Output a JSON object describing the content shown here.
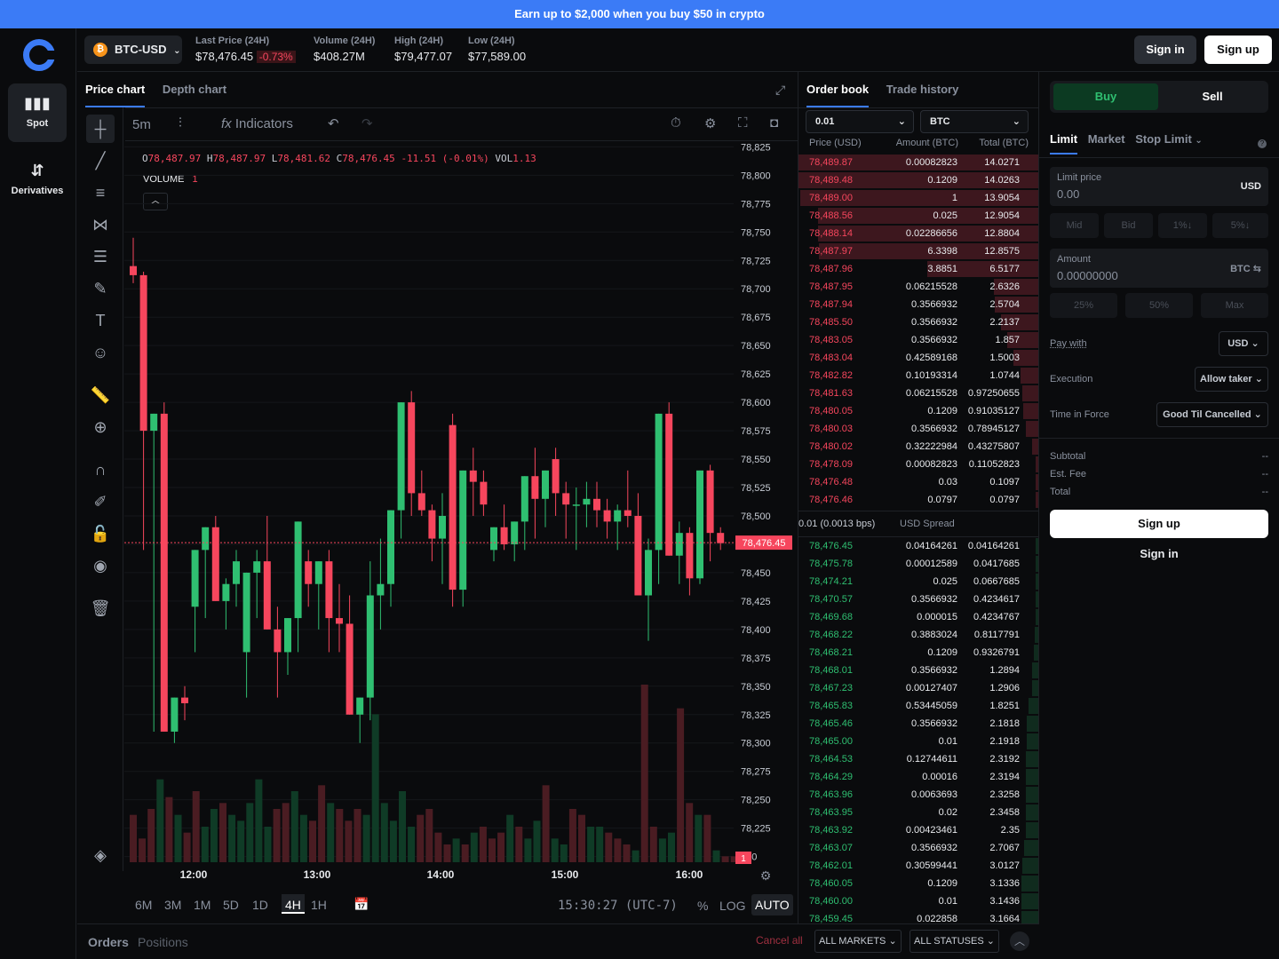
{
  "promo": "Earn up to $2,000 when you buy $50 in crypto",
  "nav": {
    "spot": "Spot",
    "derivatives": "Derivatives"
  },
  "header": {
    "pair": "BTC-USD",
    "coin_symbol": "₿",
    "last_price_label": "Last Price (24H)",
    "last_price": "$78,476.45",
    "change": "-0.73%",
    "volume_label": "Volume (24H)",
    "volume": "$408.27M",
    "high_label": "High (24H)",
    "high": "$79,477.07",
    "low_label": "Low (24H)",
    "low": "$77,589.00",
    "signin": "Sign in",
    "signup": "Sign up"
  },
  "chart_tabs": {
    "price": "Price chart",
    "depth": "Depth chart"
  },
  "toolbar": {
    "interval": "5m",
    "indicators": "Indicators"
  },
  "ohlc": {
    "o_label": "O",
    "o": "78,487.97",
    "h_label": "H",
    "h": "78,487.97",
    "l_label": "L",
    "l": "78,481.62",
    "c_label": "C",
    "c": "78,476.45",
    "delta": "-11.51 (-0.01%)",
    "vol_label": "VOL",
    "vol": "1.13"
  },
  "volume_legend": {
    "label": "VOLUME",
    "value": "1"
  },
  "current_price_tag": "78,476.45",
  "volume_axis_tag": "1",
  "timebar": {
    "ranges": [
      "6M",
      "3M",
      "1M",
      "5D",
      "1D",
      "4H",
      "1H"
    ],
    "active": "4H",
    "clock": "15:30:27 (UTC-7)",
    "pct": "%",
    "log": "LOG",
    "auto": "AUTO"
  },
  "orders_tabs": {
    "orders": "Orders",
    "positions": "Positions",
    "cancel_all": "Cancel all",
    "markets": "ALL MARKETS",
    "statuses": "ALL STATUSES"
  },
  "orderbook": {
    "tab_book": "Order book",
    "tab_history": "Trade history",
    "agg": "0.01",
    "unit": "BTC",
    "col_price": "Price (USD)",
    "col_amount": "Amount (BTC)",
    "col_total": "Total (BTC)",
    "spread": "0.01 (0.0013 bps)",
    "spread_label": "USD Spread",
    "asks": [
      [
        "78,489.87",
        "0.00082823",
        "14.0271"
      ],
      [
        "78,489.48",
        "0.1209",
        "14.0263"
      ],
      [
        "78,489.00",
        "1",
        "13.9054"
      ],
      [
        "78,488.56",
        "0.025",
        "12.9054"
      ],
      [
        "78,488.14",
        "0.02286656",
        "12.8804"
      ],
      [
        "78,487.97",
        "6.3398",
        "12.8575"
      ],
      [
        "78,487.96",
        "3.8851",
        "6.5177"
      ],
      [
        "78,487.95",
        "0.06215528",
        "2.6326"
      ],
      [
        "78,487.94",
        "0.3566932",
        "2.5704"
      ],
      [
        "78,485.50",
        "0.3566932",
        "2.2137"
      ],
      [
        "78,483.05",
        "0.3566932",
        "1.857"
      ],
      [
        "78,483.04",
        "0.42589168",
        "1.5003"
      ],
      [
        "78,482.82",
        "0.10193314",
        "1.0744"
      ],
      [
        "78,481.63",
        "0.06215528",
        "0.97250655"
      ],
      [
        "78,480.05",
        "0.1209",
        "0.91035127"
      ],
      [
        "78,480.03",
        "0.3566932",
        "0.78945127"
      ],
      [
        "78,480.02",
        "0.32222984",
        "0.43275807"
      ],
      [
        "78,478.09",
        "0.00082823",
        "0.11052823"
      ],
      [
        "78,476.48",
        "0.03",
        "0.1097"
      ],
      [
        "78,476.46",
        "0.0797",
        "0.0797"
      ]
    ],
    "bids": [
      [
        "78,476.45",
        "0.04164261",
        "0.04164261"
      ],
      [
        "78,475.78",
        "0.00012589",
        "0.0417685"
      ],
      [
        "78,474.21",
        "0.025",
        "0.0667685"
      ],
      [
        "78,470.57",
        "0.3566932",
        "0.4234617"
      ],
      [
        "78,469.68",
        "0.000015",
        "0.4234767"
      ],
      [
        "78,468.22",
        "0.3883024",
        "0.8117791"
      ],
      [
        "78,468.21",
        "0.1209",
        "0.9326791"
      ],
      [
        "78,468.01",
        "0.3566932",
        "1.2894"
      ],
      [
        "78,467.23",
        "0.00127407",
        "1.2906"
      ],
      [
        "78,465.83",
        "0.53445059",
        "1.8251"
      ],
      [
        "78,465.46",
        "0.3566932",
        "2.1818"
      ],
      [
        "78,465.00",
        "0.01",
        "2.1918"
      ],
      [
        "78,464.53",
        "0.12744611",
        "2.3192"
      ],
      [
        "78,464.29",
        "0.00016",
        "2.3194"
      ],
      [
        "78,463.96",
        "0.0063693",
        "2.3258"
      ],
      [
        "78,463.95",
        "0.02",
        "2.3458"
      ],
      [
        "78,463.92",
        "0.00423461",
        "2.35"
      ],
      [
        "78,463.07",
        "0.3566932",
        "2.7067"
      ],
      [
        "78,462.01",
        "0.30599441",
        "3.0127"
      ],
      [
        "78,460.05",
        "0.1209",
        "3.1336"
      ],
      [
        "78,460.00",
        "0.01",
        "3.1436"
      ],
      [
        "78,459.45",
        "0.022858",
        "3.1664"
      ]
    ]
  },
  "trade": {
    "buy": "Buy",
    "sell": "Sell",
    "order_types": [
      "Limit",
      "Market",
      "Stop Limit"
    ],
    "limit_price_label": "Limit price",
    "limit_price_value": "0.00",
    "limit_currency": "USD",
    "quick_price": [
      "Mid",
      "Bid",
      "1%↓",
      "5%↓"
    ],
    "amount_label": "Amount",
    "amount_value": "0.00000000",
    "amount_currency": "BTC ⇆",
    "quick_amount": [
      "25%",
      "50%",
      "Max"
    ],
    "pay_with_label": "Pay with",
    "pay_with_value": "USD",
    "execution_label": "Execution",
    "execution_value": "Allow taker",
    "tif_label": "Time in Force",
    "tif_value": "Good Til Cancelled",
    "subtotal_label": "Subtotal",
    "fee_label": "Est. Fee",
    "total_label": "Total",
    "empty_value": "--",
    "signup": "Sign up",
    "signin": "Sign in"
  },
  "chart_data": {
    "type": "candlestick",
    "y_ticks": [
      78825,
      78800,
      78775,
      78750,
      78725,
      78700,
      78675,
      78650,
      78625,
      78600,
      78575,
      78550,
      78525,
      78500,
      78475,
      78450,
      78425,
      78400,
      78375,
      78350,
      78325,
      78300,
      78275,
      78250,
      78225,
      78200
    ],
    "y_tick_labels": [
      "78,825",
      "78,800",
      "78,775",
      "78,750",
      "78,725",
      "78,700",
      "78,675",
      "78,650",
      "78,625",
      "78,600",
      "78,575",
      "78,550",
      "78,525",
      "78,500",
      "",
      "78,450",
      "78,425",
      "78,400",
      "78,375",
      "78,350",
      "78,325",
      "78,300",
      "78,275",
      "78,250",
      "78,225",
      "200"
    ],
    "ylim": [
      78195,
      78830
    ],
    "x_labels": [
      "12:00",
      "13:00",
      "14:00",
      "15:00",
      "16:00"
    ],
    "candles": [
      [
        78720,
        78745,
        78705,
        78712
      ],
      [
        78712,
        78715,
        78470,
        78575
      ],
      [
        78575,
        78580,
        78310,
        78590
      ],
      [
        78590,
        78600,
        78330,
        78310
      ],
      [
        78310,
        78320,
        78300,
        78340
      ],
      [
        78340,
        78350,
        78320,
        78335
      ],
      [
        78420,
        78450,
        78380,
        78470
      ],
      [
        78470,
        78490,
        78410,
        78490
      ],
      [
        78490,
        78500,
        78440,
        78425
      ],
      [
        78425,
        78445,
        78400,
        78440
      ],
      [
        78440,
        78470,
        78420,
        78460
      ],
      [
        78380,
        78420,
        78340,
        78450
      ],
      [
        78450,
        78470,
        78410,
        78460
      ],
      [
        78460,
        78500,
        78430,
        78400
      ],
      [
        78400,
        78420,
        78340,
        78380
      ],
      [
        78380,
        78410,
        78360,
        78410
      ],
      [
        78410,
        78480,
        78380,
        78495
      ],
      [
        78460,
        78470,
        78420,
        78440
      ],
      [
        78440,
        78460,
        78400,
        78460
      ],
      [
        78460,
        78470,
        78380,
        78410
      ],
      [
        78410,
        78440,
        78380,
        78405
      ],
      [
        78405,
        78430,
        78360,
        78325
      ],
      [
        78325,
        78340,
        78300,
        78340
      ],
      [
        78340,
        78460,
        78320,
        78430
      ],
      [
        78430,
        78480,
        78400,
        78440
      ],
      [
        78440,
        78500,
        78420,
        78505
      ],
      [
        78505,
        78590,
        78480,
        78600
      ],
      [
        78600,
        78610,
        78500,
        78520
      ],
      [
        78520,
        78540,
        78500,
        78505
      ],
      [
        78505,
        78510,
        78460,
        78480
      ],
      [
        78480,
        78520,
        78440,
        78500
      ],
      [
        78580,
        78590,
        78420,
        78435
      ],
      [
        78435,
        78450,
        78420,
        78540
      ],
      [
        78540,
        78560,
        78500,
        78530
      ],
      [
        78530,
        78540,
        78500,
        78510
      ],
      [
        78470,
        78480,
        78460,
        78490
      ],
      [
        78490,
        78510,
        78470,
        78475
      ],
      [
        78475,
        78490,
        78460,
        78495
      ],
      [
        78495,
        78510,
        78470,
        78535
      ],
      [
        78535,
        78560,
        78480,
        78515
      ],
      [
        78515,
        78540,
        78490,
        78540
      ],
      [
        78550,
        78560,
        78500,
        78520
      ],
      [
        78520,
        78530,
        78480,
        78510
      ],
      [
        78510,
        78525,
        78470,
        78510
      ],
      [
        78510,
        78530,
        78490,
        78515
      ],
      [
        78515,
        78530,
        78490,
        78505
      ],
      [
        78505,
        78515,
        78480,
        78495
      ],
      [
        78495,
        78510,
        78470,
        78505
      ],
      [
        78505,
        78540,
        78490,
        78500
      ],
      [
        78500,
        78520,
        78480,
        78430
      ],
      [
        78430,
        78480,
        78390,
        78470
      ],
      [
        78470,
        78500,
        78440,
        78590
      ],
      [
        78590,
        78600,
        78500,
        78465
      ],
      [
        78465,
        78495,
        78440,
        78485
      ],
      [
        78485,
        78490,
        78430,
        78445
      ],
      [
        78445,
        78480,
        78440,
        78540
      ],
      [
        78540,
        78545,
        78460,
        78485
      ],
      [
        78485,
        78490,
        78470,
        78476
      ]
    ],
    "volumes": [
      8,
      4,
      9,
      14,
      11,
      8,
      5,
      12,
      6,
      9,
      10,
      8,
      7,
      10,
      14,
      6,
      9,
      10,
      12,
      8,
      7,
      13,
      10,
      9,
      7,
      9,
      8,
      25,
      10,
      7,
      12,
      6,
      8,
      9,
      5,
      3,
      4,
      3,
      5,
      6,
      4,
      5,
      8,
      6,
      4,
      7,
      13,
      4,
      3,
      9,
      8,
      6,
      6,
      5,
      4,
      3,
      2,
      30,
      6,
      4,
      5,
      26,
      10,
      8,
      8,
      2,
      1,
      1
    ],
    "current_price": 78476.45
  }
}
